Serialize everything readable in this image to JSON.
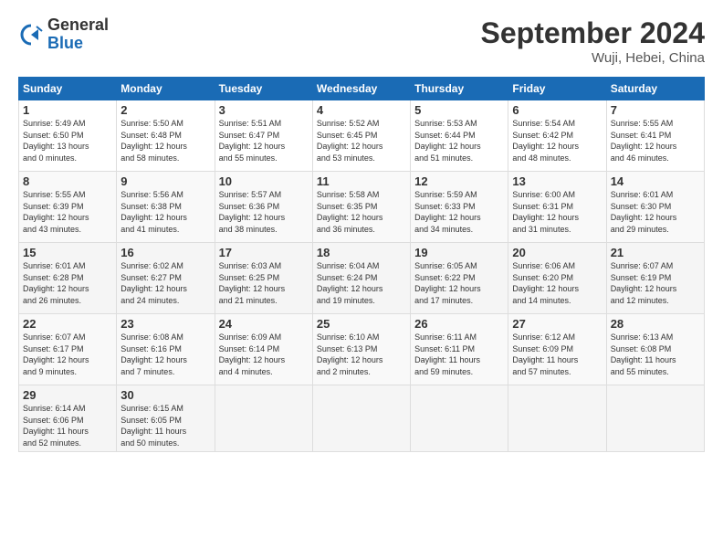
{
  "header": {
    "logo_general": "General",
    "logo_blue": "Blue",
    "title": "September 2024",
    "location": "Wuji, Hebei, China"
  },
  "days_of_week": [
    "Sunday",
    "Monday",
    "Tuesday",
    "Wednesday",
    "Thursday",
    "Friday",
    "Saturday"
  ],
  "weeks": [
    [
      {
        "num": "1",
        "sunrise": "Sunrise: 5:49 AM",
        "sunset": "Sunset: 6:50 PM",
        "daylight": "Daylight: 13 hours",
        "daylight2": "and 0 minutes."
      },
      {
        "num": "2",
        "sunrise": "Sunrise: 5:50 AM",
        "sunset": "Sunset: 6:48 PM",
        "daylight": "Daylight: 12 hours",
        "daylight2": "and 58 minutes."
      },
      {
        "num": "3",
        "sunrise": "Sunrise: 5:51 AM",
        "sunset": "Sunset: 6:47 PM",
        "daylight": "Daylight: 12 hours",
        "daylight2": "and 55 minutes."
      },
      {
        "num": "4",
        "sunrise": "Sunrise: 5:52 AM",
        "sunset": "Sunset: 6:45 PM",
        "daylight": "Daylight: 12 hours",
        "daylight2": "and 53 minutes."
      },
      {
        "num": "5",
        "sunrise": "Sunrise: 5:53 AM",
        "sunset": "Sunset: 6:44 PM",
        "daylight": "Daylight: 12 hours",
        "daylight2": "and 51 minutes."
      },
      {
        "num": "6",
        "sunrise": "Sunrise: 5:54 AM",
        "sunset": "Sunset: 6:42 PM",
        "daylight": "Daylight: 12 hours",
        "daylight2": "and 48 minutes."
      },
      {
        "num": "7",
        "sunrise": "Sunrise: 5:55 AM",
        "sunset": "Sunset: 6:41 PM",
        "daylight": "Daylight: 12 hours",
        "daylight2": "and 46 minutes."
      }
    ],
    [
      {
        "num": "8",
        "sunrise": "Sunrise: 5:55 AM",
        "sunset": "Sunset: 6:39 PM",
        "daylight": "Daylight: 12 hours",
        "daylight2": "and 43 minutes."
      },
      {
        "num": "9",
        "sunrise": "Sunrise: 5:56 AM",
        "sunset": "Sunset: 6:38 PM",
        "daylight": "Daylight: 12 hours",
        "daylight2": "and 41 minutes."
      },
      {
        "num": "10",
        "sunrise": "Sunrise: 5:57 AM",
        "sunset": "Sunset: 6:36 PM",
        "daylight": "Daylight: 12 hours",
        "daylight2": "and 38 minutes."
      },
      {
        "num": "11",
        "sunrise": "Sunrise: 5:58 AM",
        "sunset": "Sunset: 6:35 PM",
        "daylight": "Daylight: 12 hours",
        "daylight2": "and 36 minutes."
      },
      {
        "num": "12",
        "sunrise": "Sunrise: 5:59 AM",
        "sunset": "Sunset: 6:33 PM",
        "daylight": "Daylight: 12 hours",
        "daylight2": "and 34 minutes."
      },
      {
        "num": "13",
        "sunrise": "Sunrise: 6:00 AM",
        "sunset": "Sunset: 6:31 PM",
        "daylight": "Daylight: 12 hours",
        "daylight2": "and 31 minutes."
      },
      {
        "num": "14",
        "sunrise": "Sunrise: 6:01 AM",
        "sunset": "Sunset: 6:30 PM",
        "daylight": "Daylight: 12 hours",
        "daylight2": "and 29 minutes."
      }
    ],
    [
      {
        "num": "15",
        "sunrise": "Sunrise: 6:01 AM",
        "sunset": "Sunset: 6:28 PM",
        "daylight": "Daylight: 12 hours",
        "daylight2": "and 26 minutes."
      },
      {
        "num": "16",
        "sunrise": "Sunrise: 6:02 AM",
        "sunset": "Sunset: 6:27 PM",
        "daylight": "Daylight: 12 hours",
        "daylight2": "and 24 minutes."
      },
      {
        "num": "17",
        "sunrise": "Sunrise: 6:03 AM",
        "sunset": "Sunset: 6:25 PM",
        "daylight": "Daylight: 12 hours",
        "daylight2": "and 21 minutes."
      },
      {
        "num": "18",
        "sunrise": "Sunrise: 6:04 AM",
        "sunset": "Sunset: 6:24 PM",
        "daylight": "Daylight: 12 hours",
        "daylight2": "and 19 minutes."
      },
      {
        "num": "19",
        "sunrise": "Sunrise: 6:05 AM",
        "sunset": "Sunset: 6:22 PM",
        "daylight": "Daylight: 12 hours",
        "daylight2": "and 17 minutes."
      },
      {
        "num": "20",
        "sunrise": "Sunrise: 6:06 AM",
        "sunset": "Sunset: 6:20 PM",
        "daylight": "Daylight: 12 hours",
        "daylight2": "and 14 minutes."
      },
      {
        "num": "21",
        "sunrise": "Sunrise: 6:07 AM",
        "sunset": "Sunset: 6:19 PM",
        "daylight": "Daylight: 12 hours",
        "daylight2": "and 12 minutes."
      }
    ],
    [
      {
        "num": "22",
        "sunrise": "Sunrise: 6:07 AM",
        "sunset": "Sunset: 6:17 PM",
        "daylight": "Daylight: 12 hours",
        "daylight2": "and 9 minutes."
      },
      {
        "num": "23",
        "sunrise": "Sunrise: 6:08 AM",
        "sunset": "Sunset: 6:16 PM",
        "daylight": "Daylight: 12 hours",
        "daylight2": "and 7 minutes."
      },
      {
        "num": "24",
        "sunrise": "Sunrise: 6:09 AM",
        "sunset": "Sunset: 6:14 PM",
        "daylight": "Daylight: 12 hours",
        "daylight2": "and 4 minutes."
      },
      {
        "num": "25",
        "sunrise": "Sunrise: 6:10 AM",
        "sunset": "Sunset: 6:13 PM",
        "daylight": "Daylight: 12 hours",
        "daylight2": "and 2 minutes."
      },
      {
        "num": "26",
        "sunrise": "Sunrise: 6:11 AM",
        "sunset": "Sunset: 6:11 PM",
        "daylight": "Daylight: 11 hours",
        "daylight2": "and 59 minutes."
      },
      {
        "num": "27",
        "sunrise": "Sunrise: 6:12 AM",
        "sunset": "Sunset: 6:09 PM",
        "daylight": "Daylight: 11 hours",
        "daylight2": "and 57 minutes."
      },
      {
        "num": "28",
        "sunrise": "Sunrise: 6:13 AM",
        "sunset": "Sunset: 6:08 PM",
        "daylight": "Daylight: 11 hours",
        "daylight2": "and 55 minutes."
      }
    ],
    [
      {
        "num": "29",
        "sunrise": "Sunrise: 6:14 AM",
        "sunset": "Sunset: 6:06 PM",
        "daylight": "Daylight: 11 hours",
        "daylight2": "and 52 minutes."
      },
      {
        "num": "30",
        "sunrise": "Sunrise: 6:15 AM",
        "sunset": "Sunset: 6:05 PM",
        "daylight": "Daylight: 11 hours",
        "daylight2": "and 50 minutes."
      },
      null,
      null,
      null,
      null,
      null
    ]
  ]
}
